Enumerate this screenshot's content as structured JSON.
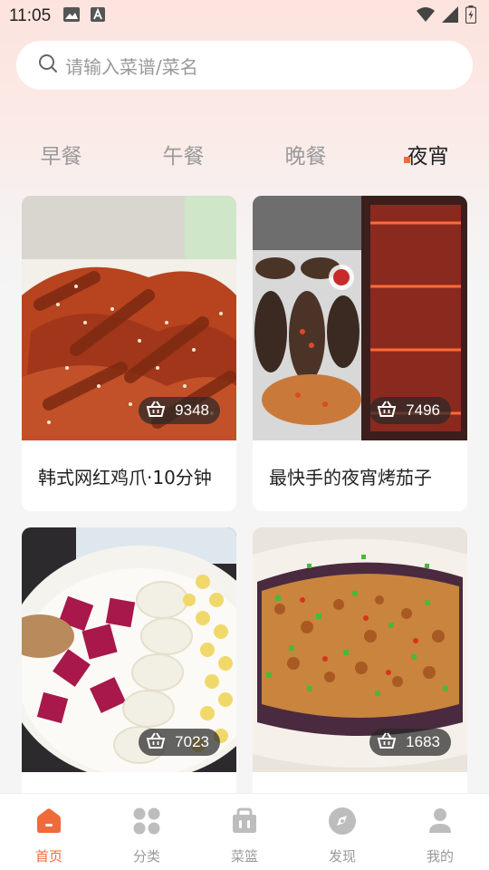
{
  "status_bar": {
    "time": "11:05"
  },
  "search": {
    "placeholder": "请输入菜谱/菜名"
  },
  "meal_tabs": [
    {
      "label": "早餐",
      "active": false
    },
    {
      "label": "午餐",
      "active": false
    },
    {
      "label": "晚餐",
      "active": false
    },
    {
      "label": "夜宵",
      "active": true
    }
  ],
  "recipes": [
    {
      "title": "韩式网红鸡爪·10分钟",
      "count": "9348"
    },
    {
      "title": "最快手的夜宵烤茄子",
      "count": "7496"
    },
    {
      "title": "",
      "count": "7023"
    },
    {
      "title": "",
      "count": "1683"
    }
  ],
  "bottom_nav": [
    {
      "label": "首页",
      "icon": "home-icon",
      "active": true
    },
    {
      "label": "分类",
      "icon": "category-icon",
      "active": false
    },
    {
      "label": "菜篮",
      "icon": "basket-icon",
      "active": false
    },
    {
      "label": "发现",
      "icon": "compass-icon",
      "active": false
    },
    {
      "label": "我的",
      "icon": "profile-icon",
      "active": false
    }
  ],
  "colors": {
    "accent": "#f06a3c",
    "inactive": "#999999"
  }
}
